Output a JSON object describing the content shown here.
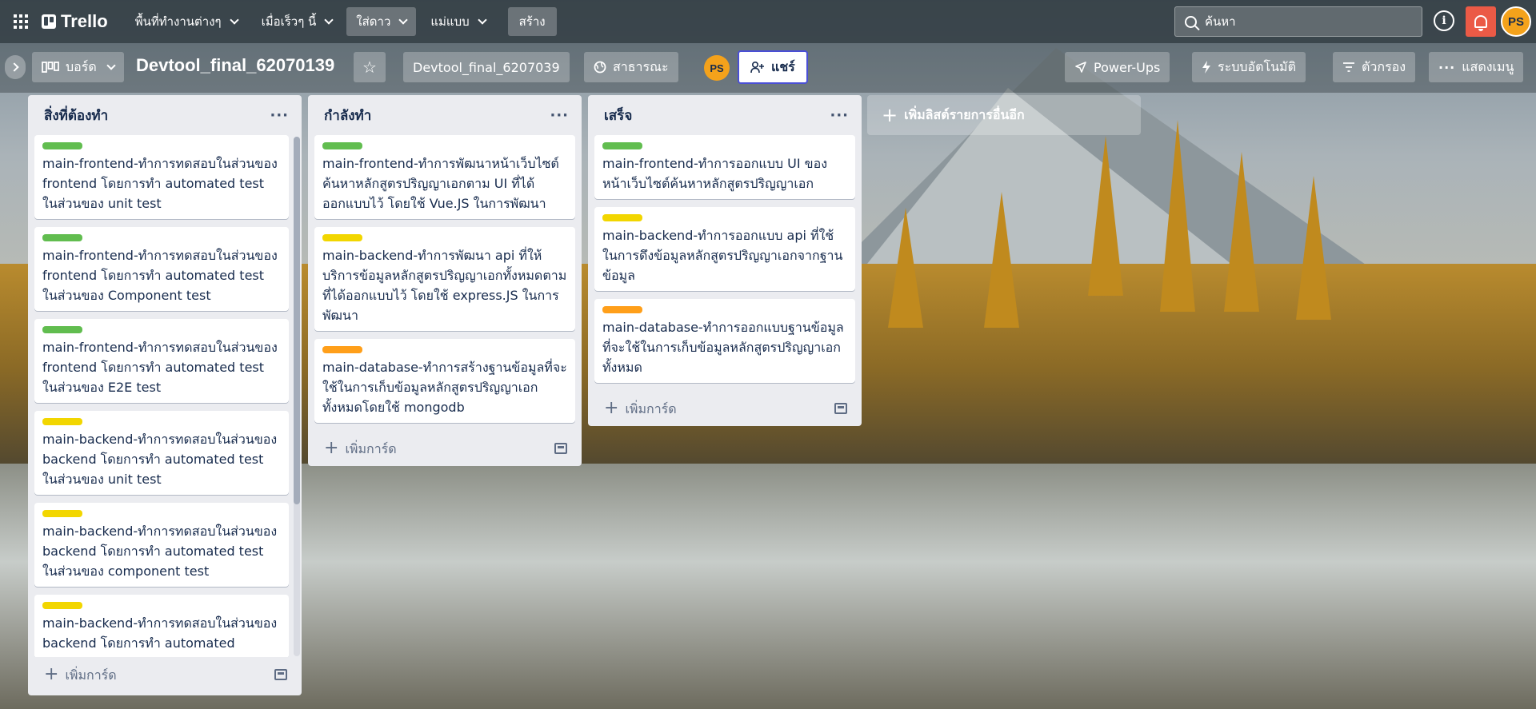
{
  "header": {
    "logo": "Trello",
    "menus": [
      {
        "label": "พื้นที่ทำงานต่างๆ",
        "active": false
      },
      {
        "label": "เมื่อเร็วๆ นี้",
        "active": false
      },
      {
        "label": "ใส่ดาว",
        "active": true
      },
      {
        "label": "แม่แบบ",
        "active": false
      }
    ],
    "create_label": "สร้าง",
    "search_placeholder": "ค้นหา",
    "avatar_initials": "PS",
    "notification_color": "#eb5a46",
    "avatar_color": "#f4a21b"
  },
  "boardbar": {
    "view_label": "บอร์ด",
    "title": "Devtool_final_62070139",
    "workspace_label": "Devtool_final_6207039",
    "visibility_label": "สาธารณะ",
    "member_initials": "PS",
    "share_label": "แชร์",
    "powerups_label": "Power-Ups",
    "automation_label": "ระบบอัตโนมัติ",
    "filter_label": "ตัวกรอง",
    "menu_label": "แสดงเมนู"
  },
  "lists": [
    {
      "title": "สิ่งที่ต้องทำ",
      "add_card_label": "เพิ่มการ์ด",
      "cards": [
        {
          "label_color": "green",
          "text": "main-frontend-ทำการทดสอบในส่วนของ frontend โดยการทำ automated test ในส่วนของ unit test"
        },
        {
          "label_color": "green",
          "text": "main-frontend-ทำการทดสอบในส่วนของ frontend โดยการทำ automated test ในส่วนของ Component test"
        },
        {
          "label_color": "green",
          "text": "main-frontend-ทำการทดสอบในส่วนของ frontend โดยการทำ automated test ในส่วนของ E2E test"
        },
        {
          "label_color": "yellow",
          "text": "main-backend-ทำการทดสอบในส่วนของ backend โดยการทำ automated test ในส่วนของ unit test"
        },
        {
          "label_color": "yellow",
          "text": "main-backend-ทำการทดสอบในส่วนของ backend โดยการทำ automated test ในส่วนของ component test"
        },
        {
          "label_color": "yellow",
          "text": "main-backend-ทำการทดสอบในส่วนของ backend โดยการทำ automated"
        }
      ]
    },
    {
      "title": "กำลังทำ",
      "add_card_label": "เพิ่มการ์ด",
      "cards": [
        {
          "label_color": "green",
          "text": "main-frontend-ทำการพัฒนาหน้าเว็บไซต์ค้นหาหลักสูตรปริญญาเอกตาม UI ที่ได้ออกแบบไว้ โดยใช้ Vue.JS ในการพัฒนา"
        },
        {
          "label_color": "yellow",
          "text": "main-backend-ทำการพัฒนา api ที่ให้บริการข้อมูลหลักสูตรปริญญาเอกทั้งหมดตามที่ได้ออกแบบไว้ โดยใช้ express.JS ในการพัฒนา"
        },
        {
          "label_color": "orange",
          "text": "main-database-ทำการสร้างฐานข้อมูลที่จะใช้ในการเก็บข้อมูลหลักสูตรปริญญาเอกทั้งหมดโดยใช้ mongodb"
        }
      ]
    },
    {
      "title": "เสร็จ",
      "add_card_label": "เพิ่มการ์ด",
      "cards": [
        {
          "label_color": "green",
          "text": "main-frontend-ทำการออกแบบ UI ของหน้าเว็บไซต์ค้นหาหลักสูตรปริญญาเอก"
        },
        {
          "label_color": "yellow",
          "text": "main-backend-ทำการออกแบบ api ที่ใช้ในการดึงข้อมูลหลักสูตรปริญญาเอกจากฐานข้อมูล"
        },
        {
          "label_color": "orange",
          "text": "main-database-ทำการออกแบบฐานข้อมูลที่จะใช้ในการเก็บข้อมูลหลักสูตรปริญญาเอกทั้งหมด"
        }
      ]
    }
  ],
  "add_list_label": "เพิ่มลิสต์รายการอื่นอีก"
}
